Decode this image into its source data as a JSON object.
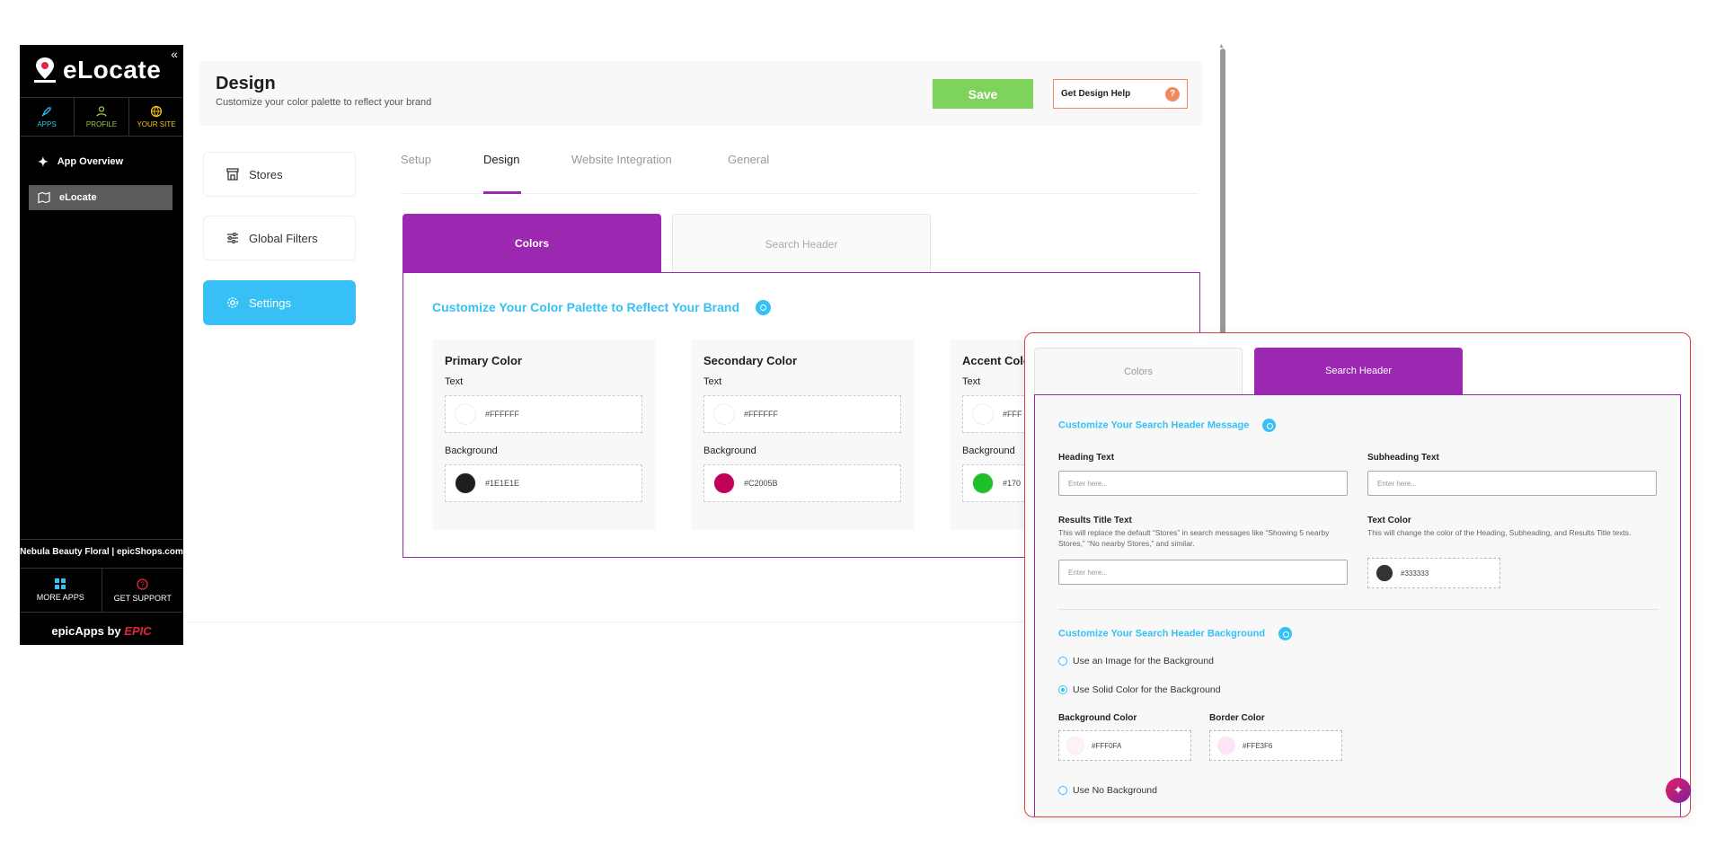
{
  "sidebar": {
    "app_name": "eLocate",
    "tabs": [
      {
        "label": "APPS",
        "icon": "rocket-icon",
        "color": "#36c0f5"
      },
      {
        "label": "PROFILE",
        "icon": "user-icon",
        "color": "#9ccc4a"
      },
      {
        "label": "YOUR SITE",
        "icon": "site-icon",
        "color": "#f5c518"
      }
    ],
    "items": [
      {
        "label": "App Overview",
        "icon": "sparkle-icon"
      },
      {
        "label": "eLocate",
        "icon": "map-icon"
      }
    ],
    "shop_name": "Nebula Beauty Floral | epicShops.com",
    "more_apps": "MORE APPS",
    "get_support": "GET SUPPORT",
    "footer_prefix": "epicApps by",
    "footer_brand": "EPIC"
  },
  "header": {
    "title": "Design",
    "subtitle": "Customize your color palette to reflect your brand",
    "save_label": "Save",
    "help_label": "Get Design Help",
    "help_icon": "?"
  },
  "left_nav": [
    {
      "label": "Stores",
      "icon": "store-icon"
    },
    {
      "label": "Global Filters",
      "icon": "sliders-icon"
    },
    {
      "label": "Settings",
      "icon": "gear-icon"
    }
  ],
  "tabs": [
    {
      "label": "Setup"
    },
    {
      "label": "Design"
    },
    {
      "label": "Website Integration"
    },
    {
      "label": "General"
    }
  ],
  "design_tabs": [
    "Colors",
    "Search Header"
  ],
  "colors_section": {
    "title": "Customize Your Color Palette to Reflect Your Brand",
    "text_label": "Text",
    "background_label": "Background",
    "cards": [
      {
        "title": "Primary Color",
        "text": "#FFFFFF",
        "background": "#1E1E1E"
      },
      {
        "title": "Secondary Color",
        "text": "#FFFFFF",
        "background": "#C2005B"
      },
      {
        "title": "Accent Colo",
        "text": "#FFF",
        "background": "#170",
        "background_swatch": "#1dbf2a"
      }
    ]
  },
  "overlay": {
    "tabs": [
      "Colors",
      "Search Header"
    ],
    "message_title": "Customize Your Search Header Message",
    "heading_label": "Heading Text",
    "heading_placeholder": "Enter here...",
    "subheading_label": "Subheading Text",
    "subheading_placeholder": "Enter here...",
    "results_label": "Results Title Text",
    "results_help": "This will replace the default “Stores” in search messages like “Showing 5 nearby Stores,” “No nearby Stores,” and similar.",
    "results_placeholder": "Enter here...",
    "text_color_label": "Text Color",
    "text_color_help": "This will change the color of the Heading, Subheading, and Results Title texts.",
    "text_color_value": "#333333",
    "background_title": "Customize Your Search Header Background",
    "options": [
      {
        "label": "Use an Image for the Background",
        "selected": false
      },
      {
        "label": "Use Solid Color for the Background",
        "selected": true
      }
    ],
    "bg_color_label": "Background Color",
    "bg_color_value": "#FFF0FA",
    "border_color_label": "Border Color",
    "border_color_value": "#FFE3F6",
    "no_bg_label": "Use No Background"
  },
  "colors": {
    "accent_purple": "#9c27b0",
    "accent_blue": "#36c0f5",
    "save_green": "#7dd35b",
    "help_orange": "#f08a5d"
  }
}
